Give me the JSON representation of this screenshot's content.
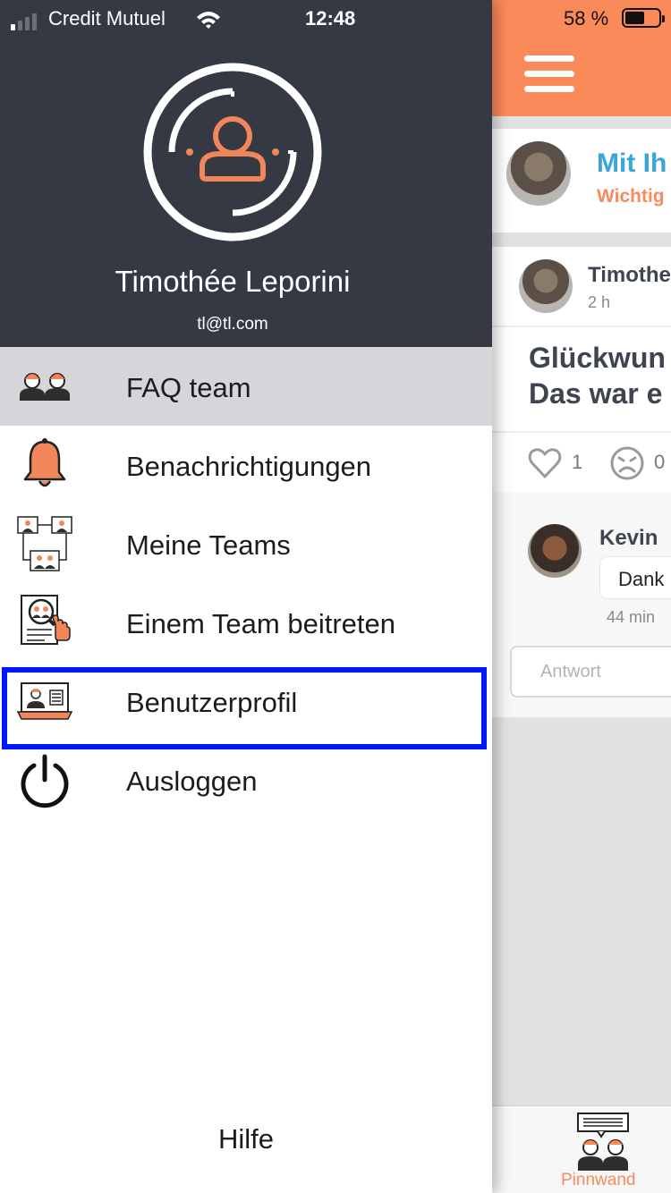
{
  "status_bar": {
    "carrier": "Credit Mutuel",
    "time": "12:48",
    "battery": "58 %",
    "battery_level": 0.58
  },
  "app": {
    "promo_card": {
      "title": "Mit Ih",
      "subtitle": "Wichtig"
    },
    "post": {
      "author": "Timothe",
      "time": "2 h",
      "text_line1": "Glückwun",
      "text_line2": "Das war e",
      "like_count": "1",
      "sad_count": "0"
    },
    "comment": {
      "author": "Kevin",
      "text": "Dank",
      "time": "44 min"
    },
    "reply_placeholder": "Antwort",
    "tabbar": {
      "pinnwand_label": "Pinnwand"
    },
    "colors": {
      "accent_orange": "#fb8a5a",
      "link_blue": "#3aa5dc"
    }
  },
  "drawer": {
    "user": {
      "name": "Timothée Leporini",
      "email": "tl@tl.com"
    },
    "menu": [
      {
        "label": "FAQ team",
        "icon": "team-faq-icon",
        "selected": true
      },
      {
        "label": "Benachrichtigungen",
        "icon": "bell-icon"
      },
      {
        "label": "Meine Teams",
        "icon": "teams-icon"
      },
      {
        "label": "Einem Team beitreten",
        "icon": "join-team-icon"
      },
      {
        "label": "Benutzerprofil",
        "icon": "profile-card-icon",
        "highlighted": true
      },
      {
        "label": "Ausloggen",
        "icon": "power-icon"
      }
    ],
    "help_label": "Hilfe",
    "colors": {
      "header_bg": "#343943",
      "selected_bg": "#d6d6da",
      "highlight_border": "#0015ff"
    }
  }
}
